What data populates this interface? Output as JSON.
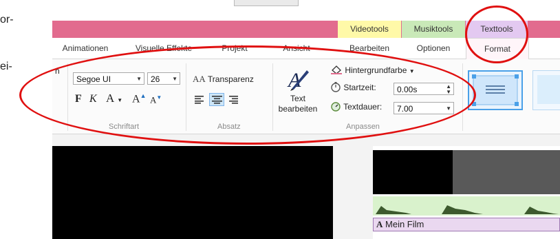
{
  "doc": {
    "line1": "or-",
    "line2": "ei-"
  },
  "contextual_tabs": [
    {
      "label": "Videotools",
      "bg": "#fff9a8"
    },
    {
      "label": "Musiktools",
      "bg": "#c9e9b8"
    },
    {
      "label": "Texttools",
      "bg": "#e3c9f1"
    }
  ],
  "tabs": [
    {
      "label": "Animationen"
    },
    {
      "label": "Visuelle Effekte"
    },
    {
      "label": "Projekt"
    },
    {
      "label": "Ansicht"
    },
    {
      "label": "Bearbeiten"
    },
    {
      "label": "Optionen"
    },
    {
      "label": "Format",
      "active": true
    }
  ],
  "ribbon": {
    "left_fragment": "n",
    "schriftart": {
      "group_label": "Schriftart",
      "font_name": "Segoe UI",
      "font_size": "26",
      "bold": "F",
      "italic": "K",
      "color_a": "A",
      "grow": "A",
      "shrink": "A"
    },
    "absatz": {
      "group_label": "Absatz",
      "transparency_label": "Transparenz",
      "transparency_icon": "AA"
    },
    "anpassen": {
      "group_label": "Anpassen",
      "edit_text_label": "Text bearbeiten",
      "background_color_label": "Hintergrundfarbe",
      "start_label": "Startzeit:",
      "start_value": "0.00s",
      "duration_label": "Textdauer:",
      "duration_value": "7.00"
    }
  },
  "timeline": {
    "text_track_label": "Mein Film",
    "text_track_icon": "A"
  },
  "colors": {
    "accent_pink": "#e26b8e",
    "highlight_red": "#e01010",
    "align_selected": "#cde6f7"
  }
}
